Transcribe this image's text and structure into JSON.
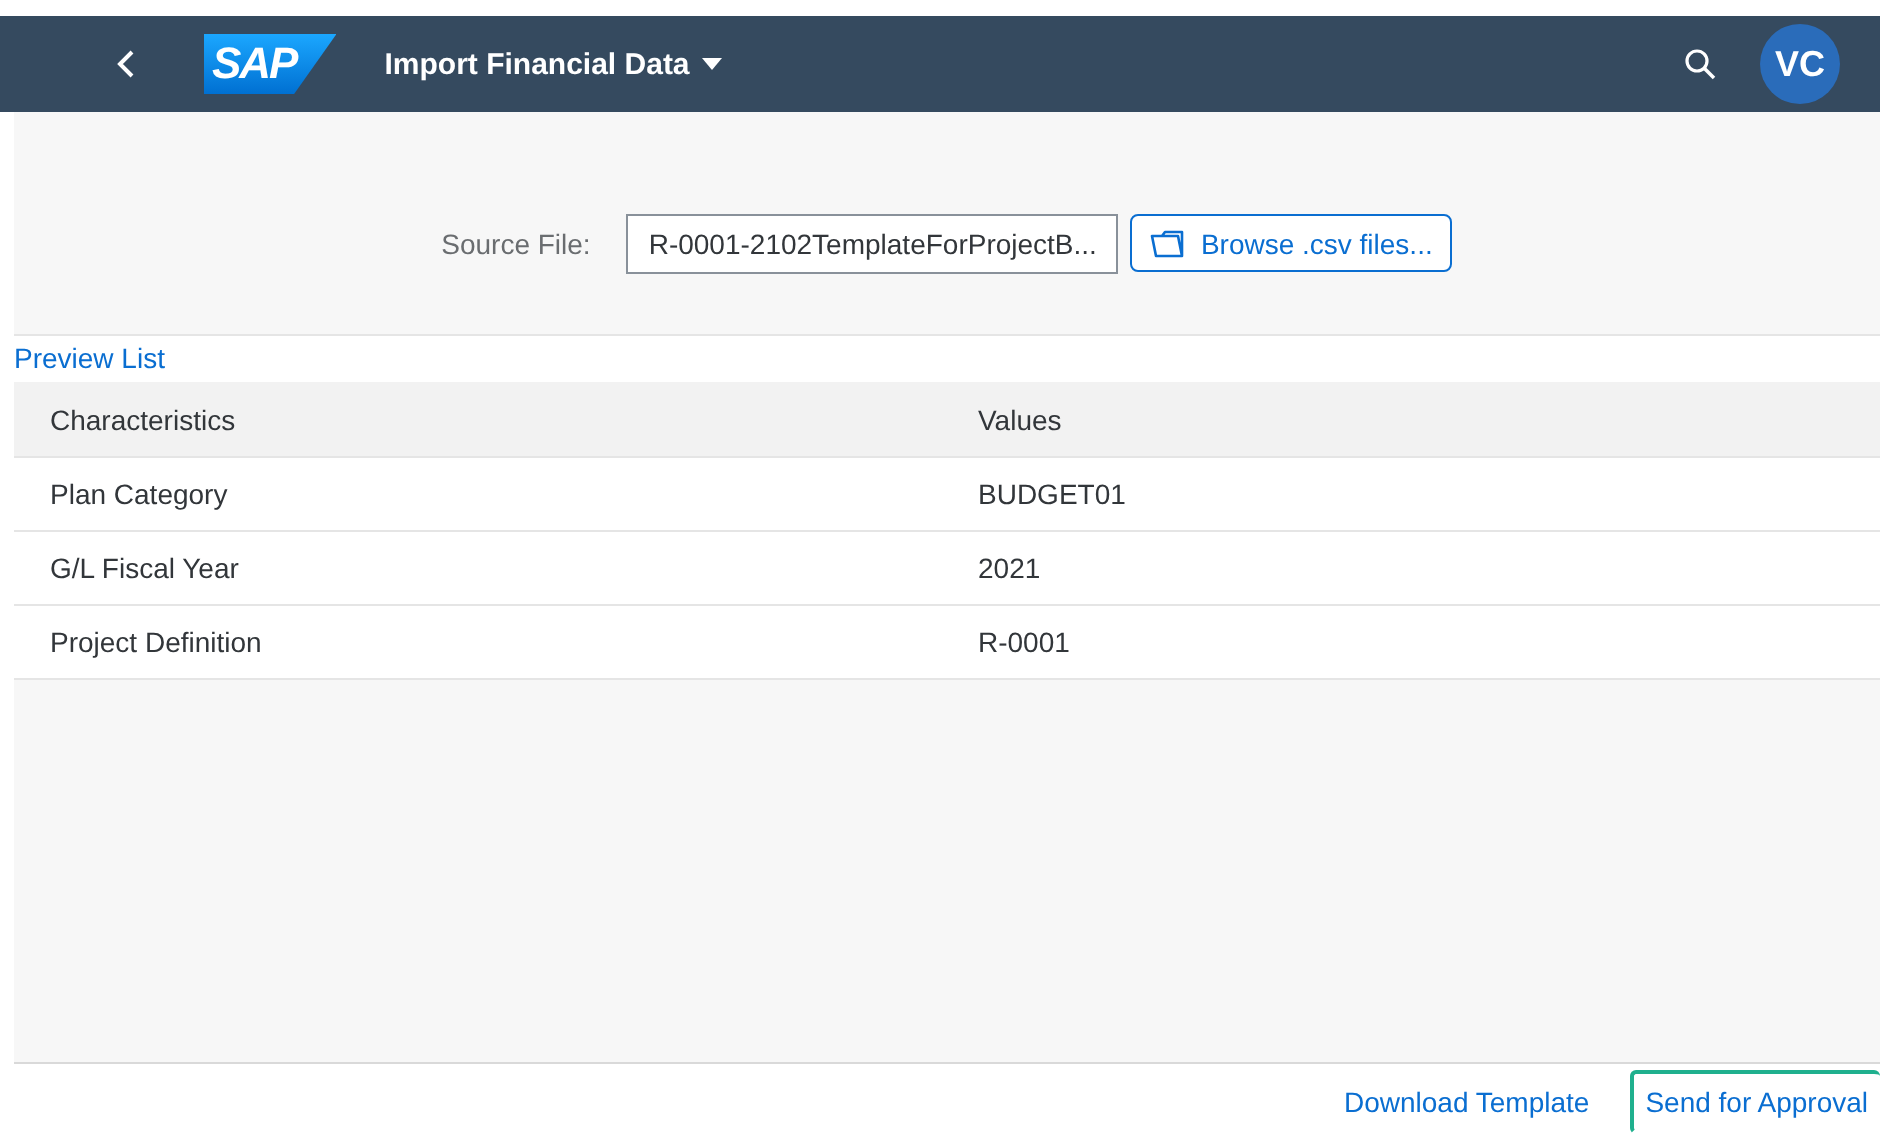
{
  "shell_bar": {
    "title": "Import Financial Data",
    "logo": "SAP",
    "avatar": "VC"
  },
  "upload": {
    "label": "Source File:",
    "value": "R-0001-2102TemplateForProjectB...",
    "browse_button": "Browse .csv files..."
  },
  "preview_link": "Preview List",
  "table": {
    "columns": [
      "Characteristics",
      "Values"
    ],
    "rows": [
      [
        "Plan Category",
        "BUDGET01"
      ],
      [
        "G/L Fiscal Year",
        "2021"
      ],
      [
        "Project Definition",
        "R-0001"
      ]
    ]
  },
  "footer_buttons": [
    {
      "label": "Download Template",
      "highlighted": false
    },
    {
      "label": "Send for Approval",
      "highlighted": true
    }
  ]
}
